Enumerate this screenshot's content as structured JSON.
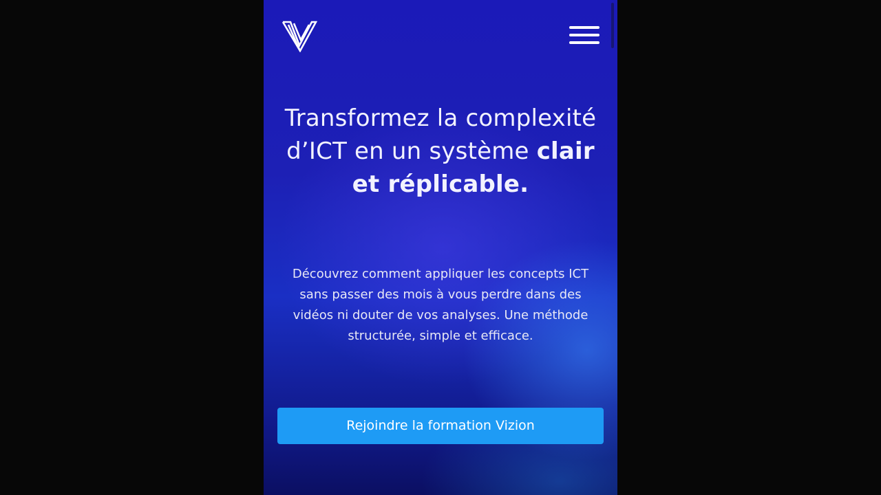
{
  "header": {
    "logo_icon": "vizion-v-logo-icon",
    "menu_icon": "hamburger-menu-icon"
  },
  "hero": {
    "title_regular": "Transformez la complexité d’ICT en un système ",
    "title_bold": "clair et réplicable.",
    "description": "Découvrez comment appliquer les concepts ICT sans passer des mois à vous perdre dans des vidéos ni douter de vos analyses. Une méthode structurée, simple et efficace.",
    "cta_label": "Rejoindre la formation Vizion"
  },
  "colors": {
    "page_background": "#070707",
    "hero_background": "#1b1ab8",
    "cta_background": "#1e9bf5",
    "text": "#ffffff"
  }
}
